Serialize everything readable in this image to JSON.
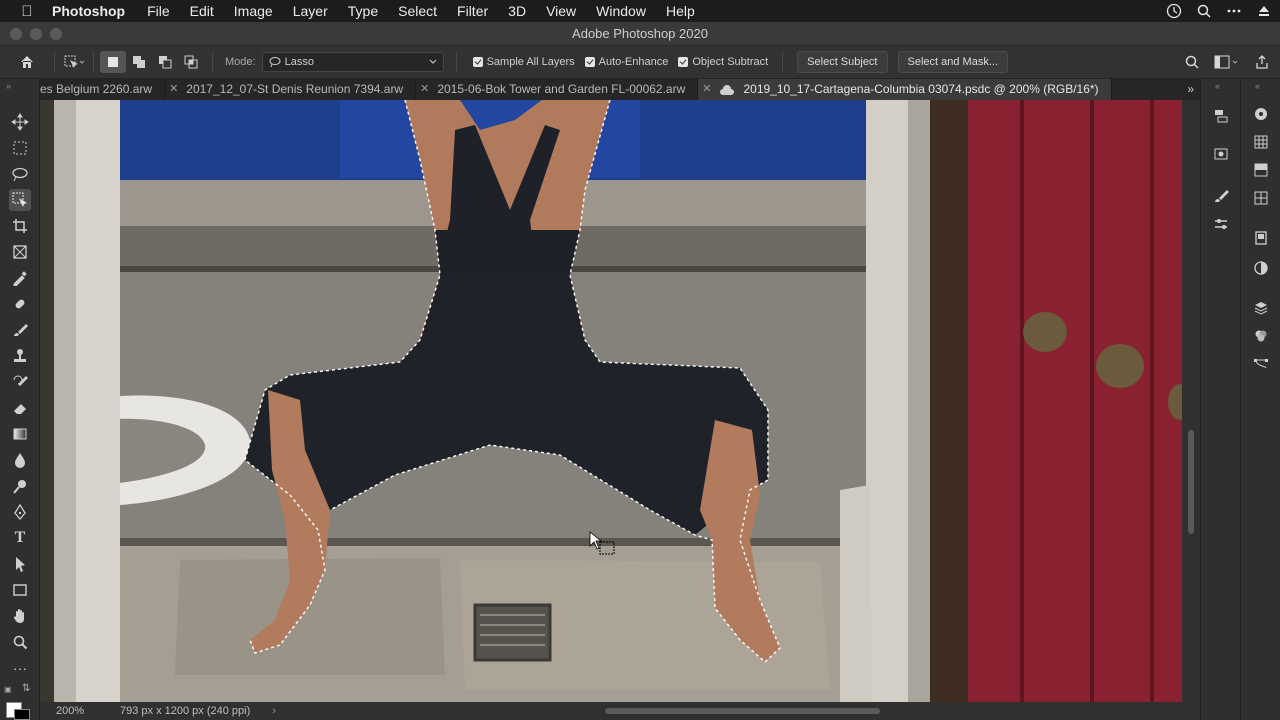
{
  "menubar": {
    "app_name": "Photoshop",
    "items": [
      "File",
      "Edit",
      "Image",
      "Layer",
      "Type",
      "Select",
      "Filter",
      "3D",
      "View",
      "Window",
      "Help"
    ]
  },
  "window": {
    "title": "Adobe Photoshop 2020"
  },
  "options_bar": {
    "mode_label": "Mode:",
    "mode_value": "Lasso",
    "sample_all_layers": "Sample All Layers",
    "auto_enhance": "Auto-Enhance",
    "object_subtract": "Object Subtract",
    "select_subject": "Select Subject",
    "select_and_mask": "Select and Mask..."
  },
  "tabs": [
    {
      "label": "es Belgium 2260.arw"
    },
    {
      "label": "2017_12_07-St Denis Reunion 7394.arw"
    },
    {
      "label": "2015-06-Bok Tower and Garden FL-00062.arw"
    },
    {
      "label": "2019_10_17-Cartagena-Columbia 03074.psdc @ 200% (RGB/16*)"
    }
  ],
  "status": {
    "zoom": "200%",
    "doc_info": "793 px x 1200 px (240 ppi)"
  },
  "colors": {
    "accent": "#505050",
    "wall_blue": "#1a3d8a",
    "door_red": "#8c2230",
    "dress": "#1f2228"
  }
}
